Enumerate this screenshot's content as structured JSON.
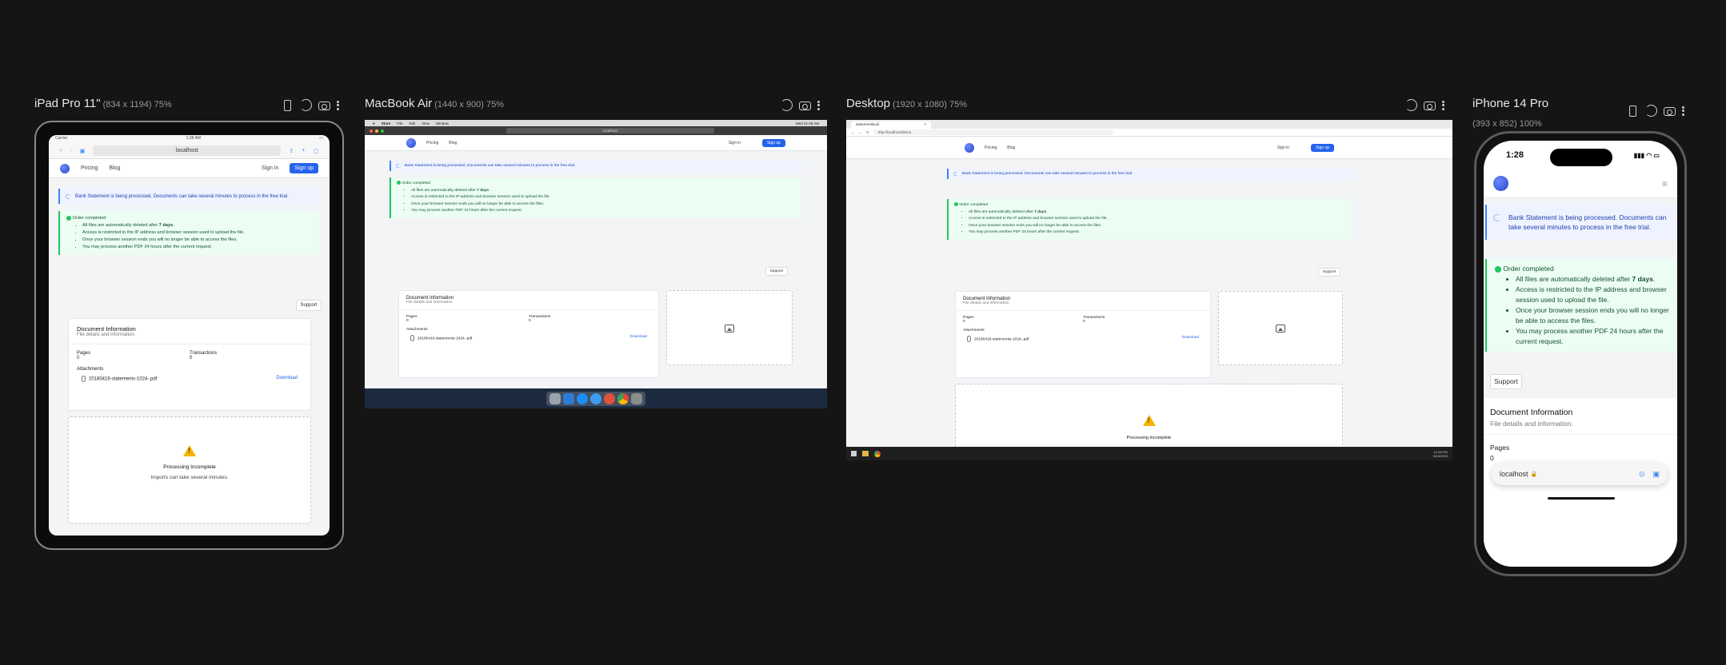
{
  "devices": [
    {
      "name": "iPad Pro 11\"",
      "dim": "(834 x 1194) 75%"
    },
    {
      "name": "MacBook Air",
      "dim": "(1440 x 900) 75%"
    },
    {
      "name": "Desktop",
      "dim": "(1920 x 1080) 75%"
    },
    {
      "name": "iPhone 14 Pro",
      "dim": "(393 x 852) 100%"
    }
  ],
  "site": {
    "nav": {
      "pricing": "Pricing",
      "blog": "Blog",
      "signin": "Sign in",
      "signup": "Sign up"
    },
    "info_banner": "Bank Statement is being processed. Documents can take several minutes to process in the free trial.",
    "order": {
      "title": "Order completed",
      "item1_prefix": "All files are automatically deleted after ",
      "item1_bold": "7 days",
      "item1_suffix": ".",
      "item2": "Access is restricted to the IP address and browser session used to upload the file.",
      "item3": "Once your browser session ends you will no longer be able to access the files.",
      "item4": "You may process another PDF 24 hours after the current request."
    },
    "support": "Support",
    "doc": {
      "title": "Document Information",
      "subtitle": "File details and information.",
      "pages_label": "Pages",
      "pages_value": "0",
      "transactions_label": "Transactions",
      "transactions_value": "0",
      "attachments_label": "Attachments",
      "filename": "20180416-statements-1024-.pdf",
      "download": "Download"
    },
    "processing": {
      "title": "Processing Incomplete",
      "subtitle": "Imports can take several minutes."
    }
  },
  "ipad": {
    "status_left": "Carrier",
    "status_time": "1:28 AM",
    "url": "localhost"
  },
  "mac": {
    "menu": [
      "Store",
      "File",
      "Edit",
      "View",
      "Window"
    ],
    "url": "localhost",
    "clock": "Wed 21:28 AM"
  },
  "desktop": {
    "tab": "statementlocal",
    "url": "http://localhost/demo",
    "clock_time": "12:28 PM",
    "clock_date": "8/16/2023"
  },
  "iphone": {
    "time": "1:28",
    "url": "localhost"
  },
  "colors": {
    "accent": "#2563eb",
    "success": "#22c55e",
    "info": "#3b82f6",
    "background": "#151515"
  }
}
